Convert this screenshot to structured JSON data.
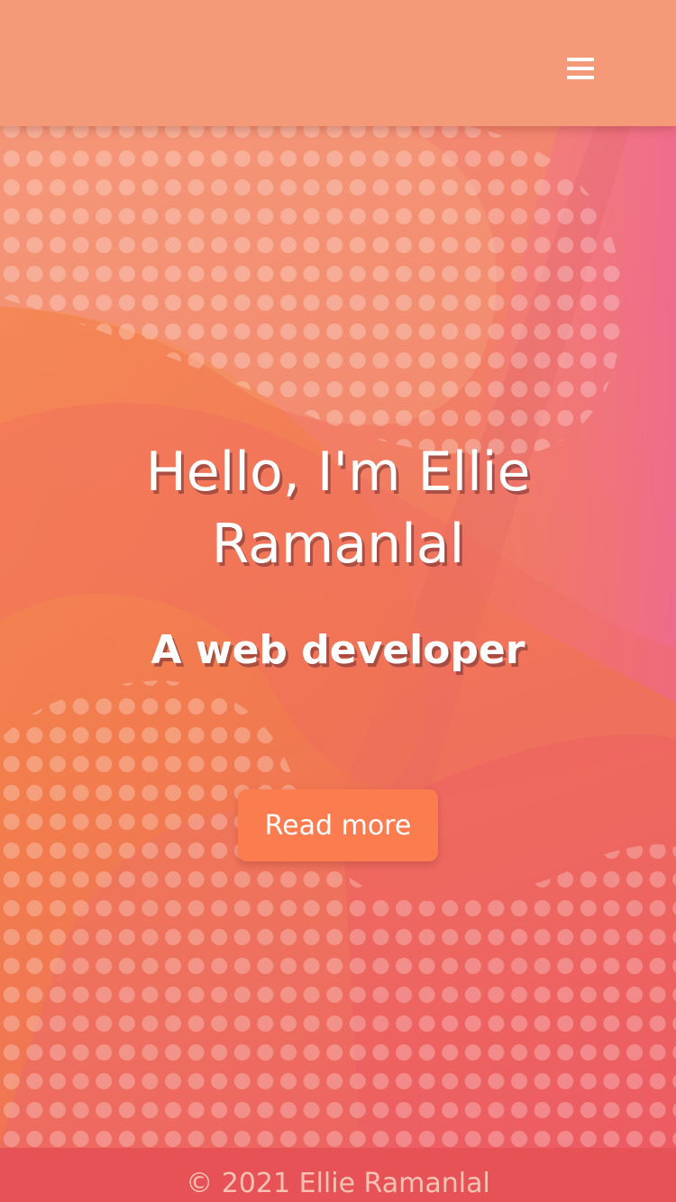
{
  "navbar": {
    "menu_icon": "hamburger-menu-icon"
  },
  "hero": {
    "title": "Hello, I'm Ellie Ramanlal",
    "subtitle": "A web developer",
    "button_label": "Read more"
  },
  "footer": {
    "copyright": "© 2021 Ellie Ramanlal"
  },
  "colors": {
    "navbar": "#f59a78",
    "button": "#fb7c4e",
    "footer": "#e65256",
    "text": "#ffffff"
  }
}
